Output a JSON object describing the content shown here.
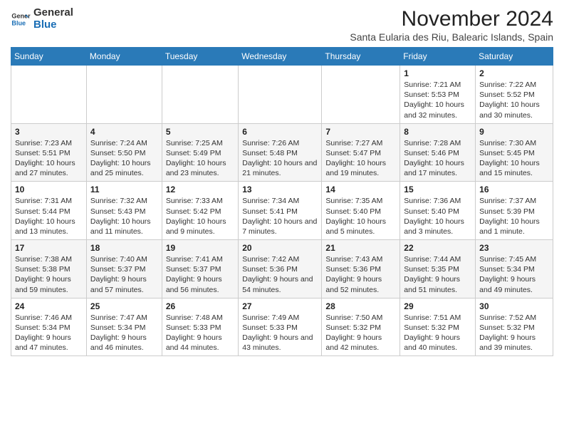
{
  "header": {
    "logo_line1": "General",
    "logo_line2": "Blue",
    "month_year": "November 2024",
    "location": "Santa Eularia des Riu, Balearic Islands, Spain"
  },
  "days_of_week": [
    "Sunday",
    "Monday",
    "Tuesday",
    "Wednesday",
    "Thursday",
    "Friday",
    "Saturday"
  ],
  "weeks": [
    [
      {
        "day": "",
        "content": ""
      },
      {
        "day": "",
        "content": ""
      },
      {
        "day": "",
        "content": ""
      },
      {
        "day": "",
        "content": ""
      },
      {
        "day": "",
        "content": ""
      },
      {
        "day": "1",
        "content": "Sunrise: 7:21 AM\nSunset: 5:53 PM\nDaylight: 10 hours and 32 minutes."
      },
      {
        "day": "2",
        "content": "Sunrise: 7:22 AM\nSunset: 5:52 PM\nDaylight: 10 hours and 30 minutes."
      }
    ],
    [
      {
        "day": "3",
        "content": "Sunrise: 7:23 AM\nSunset: 5:51 PM\nDaylight: 10 hours and 27 minutes."
      },
      {
        "day": "4",
        "content": "Sunrise: 7:24 AM\nSunset: 5:50 PM\nDaylight: 10 hours and 25 minutes."
      },
      {
        "day": "5",
        "content": "Sunrise: 7:25 AM\nSunset: 5:49 PM\nDaylight: 10 hours and 23 minutes."
      },
      {
        "day": "6",
        "content": "Sunrise: 7:26 AM\nSunset: 5:48 PM\nDaylight: 10 hours and 21 minutes."
      },
      {
        "day": "7",
        "content": "Sunrise: 7:27 AM\nSunset: 5:47 PM\nDaylight: 10 hours and 19 minutes."
      },
      {
        "day": "8",
        "content": "Sunrise: 7:28 AM\nSunset: 5:46 PM\nDaylight: 10 hours and 17 minutes."
      },
      {
        "day": "9",
        "content": "Sunrise: 7:30 AM\nSunset: 5:45 PM\nDaylight: 10 hours and 15 minutes."
      }
    ],
    [
      {
        "day": "10",
        "content": "Sunrise: 7:31 AM\nSunset: 5:44 PM\nDaylight: 10 hours and 13 minutes."
      },
      {
        "day": "11",
        "content": "Sunrise: 7:32 AM\nSunset: 5:43 PM\nDaylight: 10 hours and 11 minutes."
      },
      {
        "day": "12",
        "content": "Sunrise: 7:33 AM\nSunset: 5:42 PM\nDaylight: 10 hours and 9 minutes."
      },
      {
        "day": "13",
        "content": "Sunrise: 7:34 AM\nSunset: 5:41 PM\nDaylight: 10 hours and 7 minutes."
      },
      {
        "day": "14",
        "content": "Sunrise: 7:35 AM\nSunset: 5:40 PM\nDaylight: 10 hours and 5 minutes."
      },
      {
        "day": "15",
        "content": "Sunrise: 7:36 AM\nSunset: 5:40 PM\nDaylight: 10 hours and 3 minutes."
      },
      {
        "day": "16",
        "content": "Sunrise: 7:37 AM\nSunset: 5:39 PM\nDaylight: 10 hours and 1 minute."
      }
    ],
    [
      {
        "day": "17",
        "content": "Sunrise: 7:38 AM\nSunset: 5:38 PM\nDaylight: 9 hours and 59 minutes."
      },
      {
        "day": "18",
        "content": "Sunrise: 7:40 AM\nSunset: 5:37 PM\nDaylight: 9 hours and 57 minutes."
      },
      {
        "day": "19",
        "content": "Sunrise: 7:41 AM\nSunset: 5:37 PM\nDaylight: 9 hours and 56 minutes."
      },
      {
        "day": "20",
        "content": "Sunrise: 7:42 AM\nSunset: 5:36 PM\nDaylight: 9 hours and 54 minutes."
      },
      {
        "day": "21",
        "content": "Sunrise: 7:43 AM\nSunset: 5:36 PM\nDaylight: 9 hours and 52 minutes."
      },
      {
        "day": "22",
        "content": "Sunrise: 7:44 AM\nSunset: 5:35 PM\nDaylight: 9 hours and 51 minutes."
      },
      {
        "day": "23",
        "content": "Sunrise: 7:45 AM\nSunset: 5:34 PM\nDaylight: 9 hours and 49 minutes."
      }
    ],
    [
      {
        "day": "24",
        "content": "Sunrise: 7:46 AM\nSunset: 5:34 PM\nDaylight: 9 hours and 47 minutes."
      },
      {
        "day": "25",
        "content": "Sunrise: 7:47 AM\nSunset: 5:34 PM\nDaylight: 9 hours and 46 minutes."
      },
      {
        "day": "26",
        "content": "Sunrise: 7:48 AM\nSunset: 5:33 PM\nDaylight: 9 hours and 44 minutes."
      },
      {
        "day": "27",
        "content": "Sunrise: 7:49 AM\nSunset: 5:33 PM\nDaylight: 9 hours and 43 minutes."
      },
      {
        "day": "28",
        "content": "Sunrise: 7:50 AM\nSunset: 5:32 PM\nDaylight: 9 hours and 42 minutes."
      },
      {
        "day": "29",
        "content": "Sunrise: 7:51 AM\nSunset: 5:32 PM\nDaylight: 9 hours and 40 minutes."
      },
      {
        "day": "30",
        "content": "Sunrise: 7:52 AM\nSunset: 5:32 PM\nDaylight: 9 hours and 39 minutes."
      }
    ]
  ]
}
